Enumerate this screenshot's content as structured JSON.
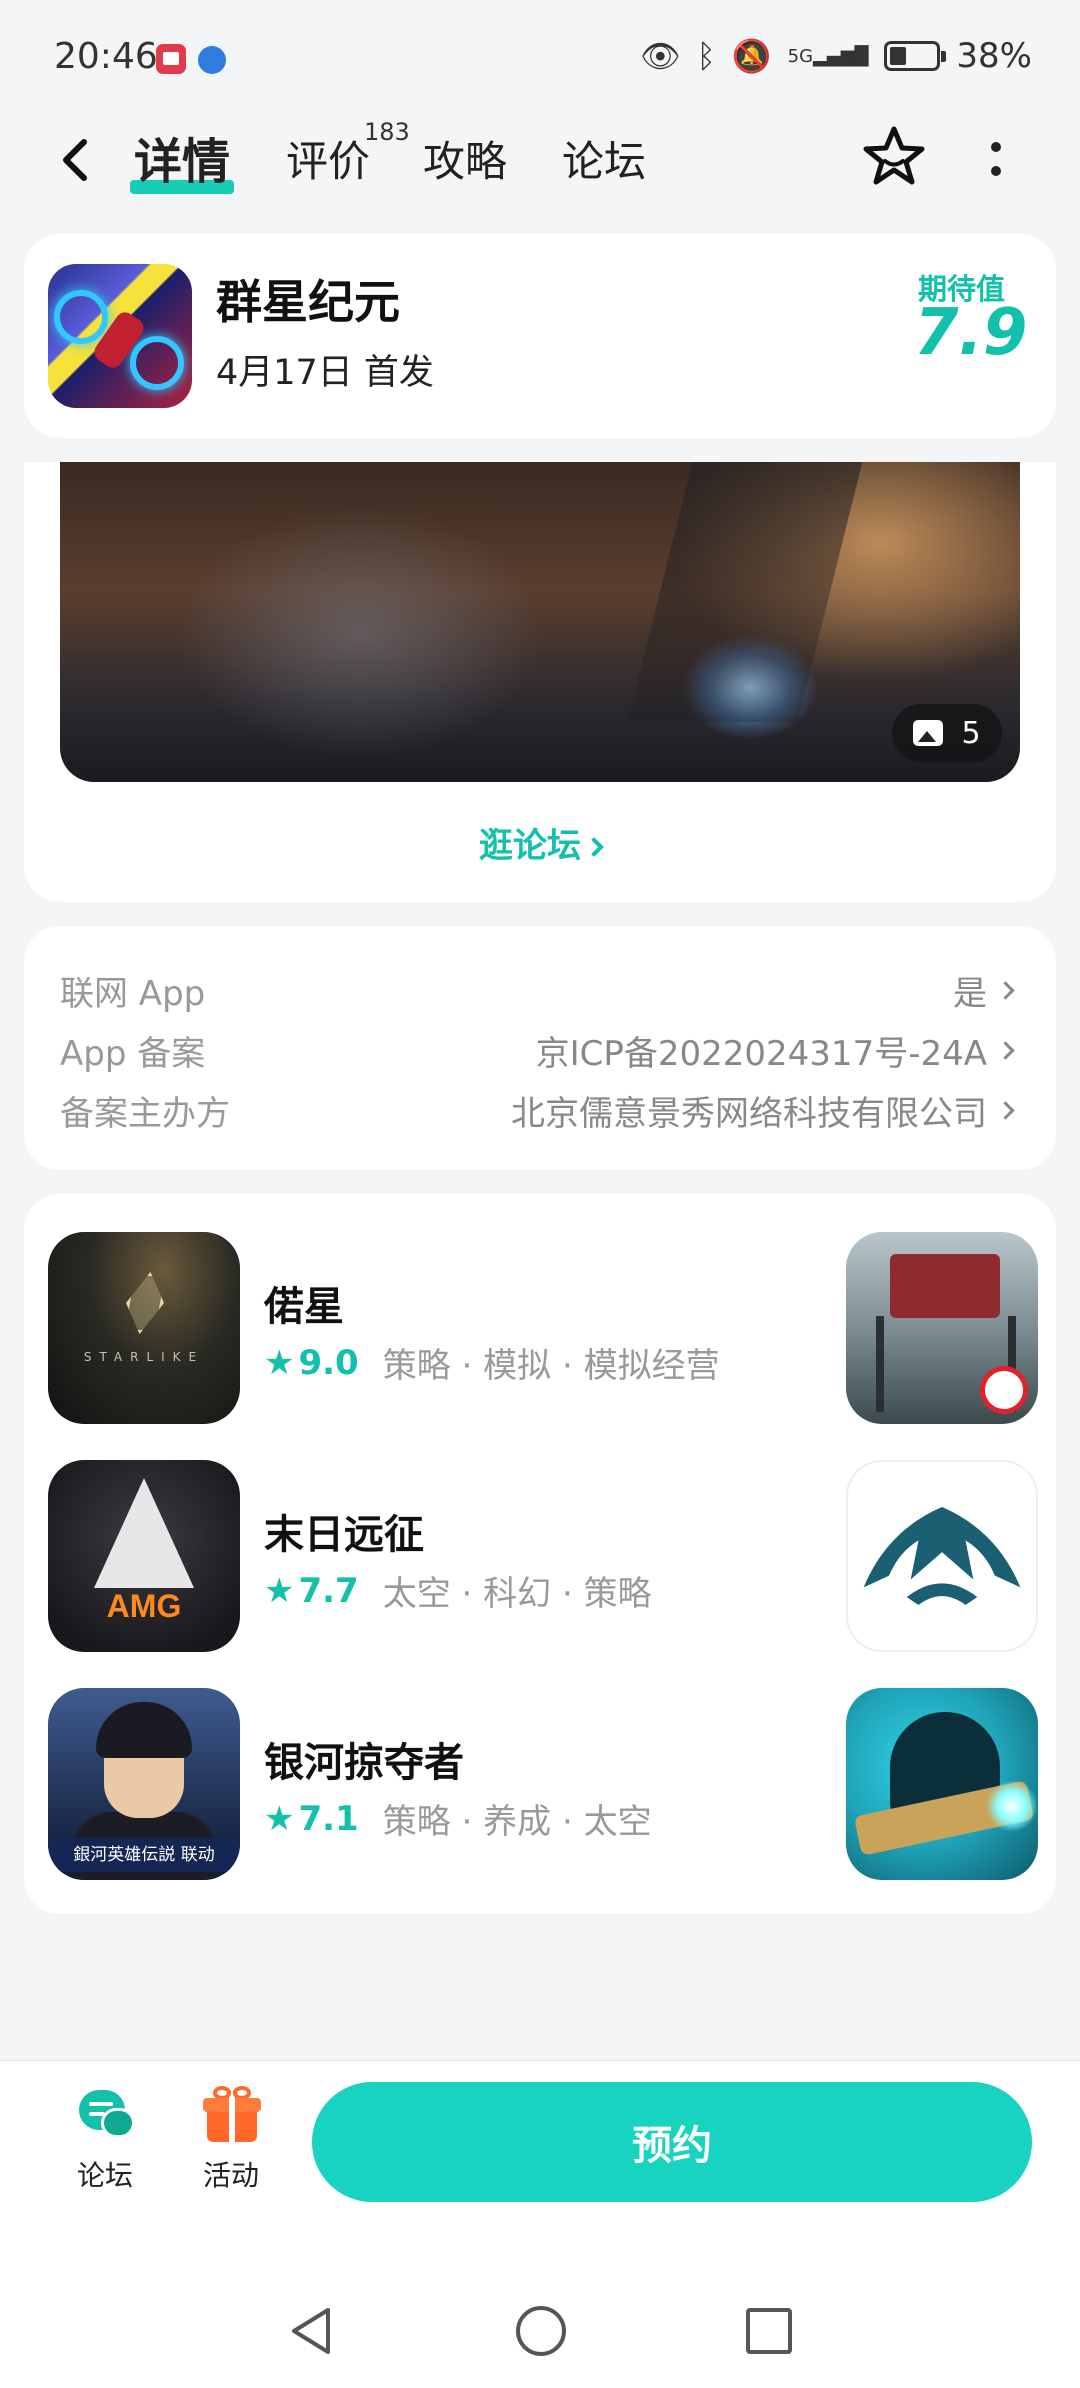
{
  "status_bar": {
    "time": "20:46",
    "network": "5G",
    "battery_percent": "38%",
    "icons": [
      "notification-app-icon",
      "browser-app-icon",
      "eye-icon",
      "bluetooth-icon",
      "mute-bell-icon",
      "signal-icon",
      "battery-icon"
    ]
  },
  "header": {
    "tabs": [
      {
        "label": "详情",
        "active": true
      },
      {
        "label": "评价",
        "badge": "183"
      },
      {
        "label": "攻略"
      },
      {
        "label": "论坛"
      }
    ]
  },
  "game": {
    "title": "群星纪元",
    "release": "4月17日 首发",
    "expect_label": "期待值",
    "expect_score": "7.9"
  },
  "media": {
    "image_count": "5",
    "forum_link": "逛论坛"
  },
  "info": {
    "rows": [
      {
        "label": "联网 App",
        "value": "是"
      },
      {
        "label": "App 备案",
        "value": "京ICP备2022024317号-24A"
      },
      {
        "label": "备案主办方",
        "value": "北京儒意景秀网络科技有限公司"
      }
    ]
  },
  "recommendations": [
    {
      "name": "偌星",
      "score": "9.0",
      "tags": "策略 · 模拟 · 模拟经营",
      "icon_text": "STARLIKE"
    },
    {
      "name": "末日远征",
      "score": "7.7",
      "tags": "太空 · 科幻 · 策略",
      "icon_text": "AMG"
    },
    {
      "name": "银河掠夺者",
      "score": "7.1",
      "tags": "策略 · 养成 · 太空",
      "icon_text": "銀河英雄伝説 联动"
    }
  ],
  "bottom_bar": {
    "forum_label": "论坛",
    "event_label": "活动",
    "reserve_label": "预约"
  },
  "colors": {
    "accent": "#13c0ab",
    "reserve_button": "#17d3c0",
    "gift": "#ff6a2a"
  }
}
